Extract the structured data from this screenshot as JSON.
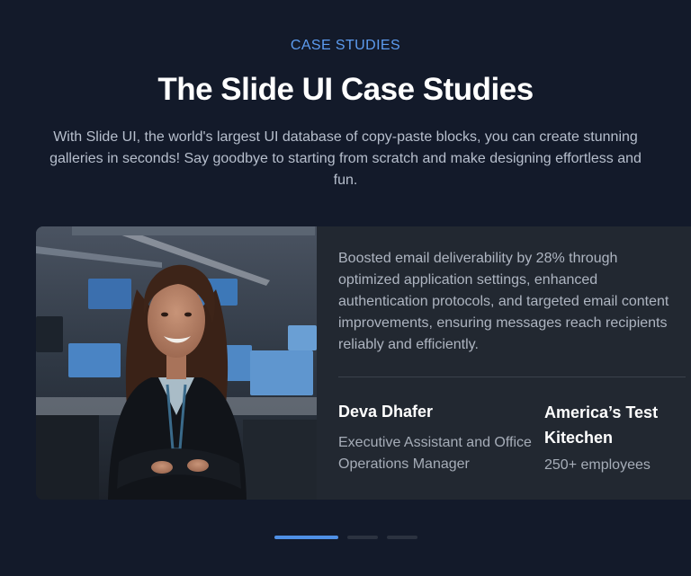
{
  "header": {
    "eyebrow": "CASE STUDIES",
    "title": "The Slide UI Case Studies",
    "description": "With Slide UI, the world's largest UI database of copy-paste blocks, you can create stunning galleries in seconds! Say goodbye to starting from scratch and make designing effortless and fun."
  },
  "case_study": {
    "photo_icon": "portrait-photo",
    "quote": "Boosted email deliverability by 28% through optimized application settings, enhanced authentication protocols, and targeted email content improvements, ensuring messages reach recipients reliably and efficiently.",
    "person": {
      "name": "Deva Dhafer",
      "role": "Executive Assistant and Office Operations Manager"
    },
    "company": {
      "name": "America’s Test Kitechen",
      "size": "250+ employees"
    }
  },
  "pagination": {
    "count": 3,
    "active_index": 0
  },
  "colors": {
    "background": "#131a2a",
    "accent": "#4f90e6",
    "card": "#222831"
  }
}
